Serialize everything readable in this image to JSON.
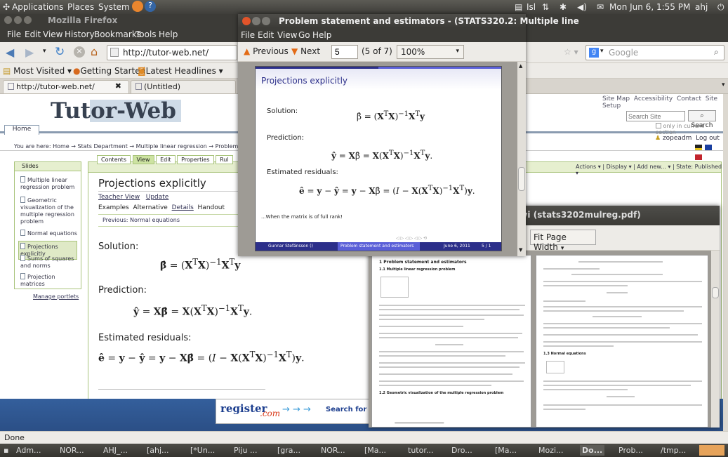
{
  "top_panel": {
    "menus": [
      "Applications",
      "Places",
      "System"
    ],
    "indicators": [
      "Isl"
    ],
    "datetime": "Mon Jun 6, 1:55 PM",
    "user": "ahj"
  },
  "firefox": {
    "title": "Mozilla Firefox",
    "menu": [
      "File",
      "Edit",
      "View",
      "History",
      "Bookmarks",
      "Tools",
      "Help"
    ],
    "url": "http://tutor-web.net/",
    "search_placeholder": "Google",
    "bookmarks": [
      "Most Visited ▾",
      "Getting Started",
      "Latest Headlines ▾"
    ],
    "tabs": [
      "http://tutor-web.net/",
      "(Untitled)"
    ],
    "status": "Done"
  },
  "tutorweb": {
    "logo": "Tutor-Web",
    "home_tab": "Home",
    "top_links": [
      "Site Map",
      "Accessibility",
      "Contact",
      "Site Setup"
    ],
    "search_placeholder": "Search Site",
    "search_button": "Search",
    "only_current": "only in current section",
    "user": "zopeadm",
    "logout": "Log out",
    "breadcrumb": "You are here: Home → Stats Department → Multiple linear regression → Problem statement a",
    "edit_tabs": [
      "Contents",
      "View",
      "Edit",
      "Properties",
      "Rul"
    ],
    "actions": [
      "Actions ▾",
      "Display ▾",
      "Add new... ▾",
      "State: Published ▾"
    ],
    "sidebar_title": "Slides",
    "slides": [
      "Multiple linear regression problem",
      "Geometric visualization of the multiple regression problem",
      "Normal equations",
      "Projections explicitly",
      "Sums of squares and norms",
      "Projection matrices"
    ],
    "manage": "Manage portlets",
    "heading": "Projections explicitly",
    "teacher_view": "Teacher View",
    "update": "Update",
    "view_links": [
      "Examples",
      "Alternative",
      "Details",
      "Handout"
    ],
    "previous": "Previous: Normal equations",
    "solution": "Solution:",
    "prediction": "Prediction:",
    "residuals": "Estimated residuals:",
    "register_banner": "register",
    "register_suffix": ".com",
    "search_for": "Search for d"
  },
  "evince": {
    "title": "Problem statement and estimators - (STATS320.2: Multiple line",
    "menu": [
      "File",
      "Edit",
      "View",
      "Go",
      "Help"
    ],
    "prev": "Previous",
    "next": "Next",
    "page": "5",
    "page_of": "(5 of 7)",
    "zoom": "100%",
    "slide_title": "Projections explicitly",
    "solution": "Solution:",
    "prediction": "Prediction:",
    "residuals": "Estimated residuals:",
    "note": "...When the matrix is of full rank!",
    "footer_author": "Gunnar Stefánsson ()",
    "footer_title": "Problem statement and estimators",
    "footer_date": "June 6, 2011",
    "footer_page": "5 / 1"
  },
  "dvi": {
    "title": "dvi (stats3202mulreg.pdf)",
    "zoom": "Fit Page Width",
    "sec1": "1    Problem statement and estimators",
    "sub1": "1.1    Multiple linear regression problem",
    "sub2": "1.2    Geometric visualization of the multiple regression problem",
    "sub3": "1.3    Normal equations"
  },
  "taskbar": [
    "Adm...",
    "NOR...",
    "AHJ_...",
    "[ahj...",
    "[*Un...",
    "Piju ...",
    "[gra...",
    "NOR...",
    "[Ma...",
    "tutor...",
    "Dro...",
    "[Ma...",
    "Mozi...",
    "Do...",
    "Prob...",
    "/tmp..."
  ]
}
